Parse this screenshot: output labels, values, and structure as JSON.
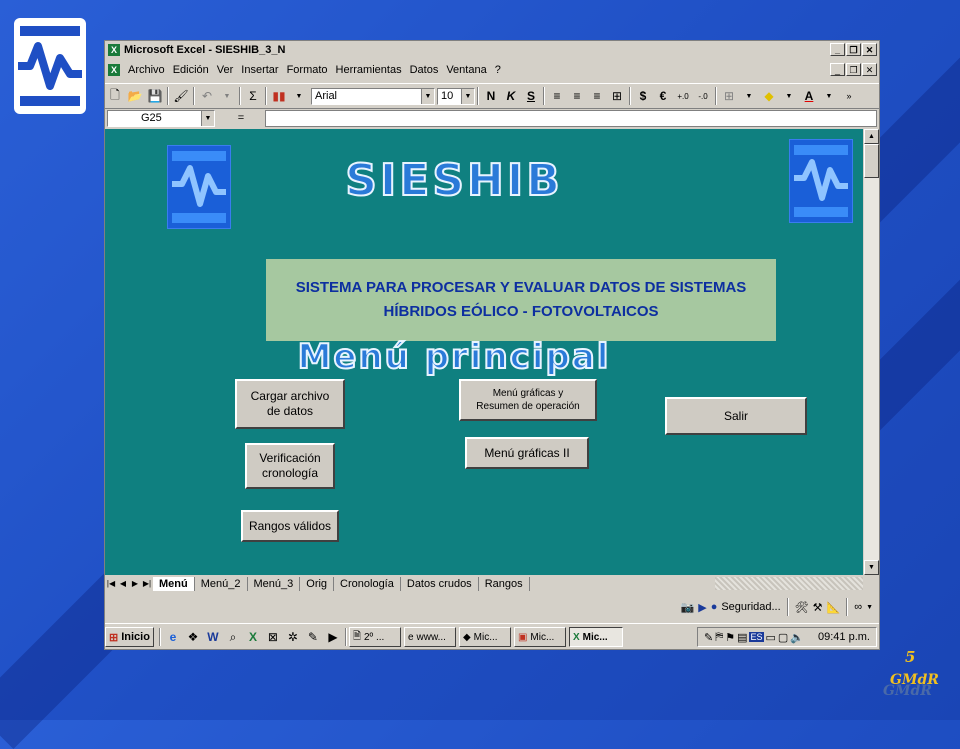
{
  "window": {
    "title": "Microsoft Excel - SIESHIB_3_N",
    "app_icon": "excel-icon"
  },
  "menu": {
    "items": [
      "Archivo",
      "Edición",
      "Ver",
      "Insertar",
      "Formato",
      "Herramientas",
      "Datos",
      "Ventana",
      "?"
    ]
  },
  "toolbar": {
    "font_name": "Arial",
    "font_size": "10",
    "bold_label": "N",
    "italic_label": "K",
    "underline_label": "S",
    "currency_label": "$",
    "euro_label": "€"
  },
  "formula_bar": {
    "name_box": "G25",
    "equals": "="
  },
  "sheet": {
    "app_name": "SIESHIB",
    "subtitle_line1": "SISTEMA PARA PROCESAR Y EVALUAR DATOS DE SISTEMAS",
    "subtitle_line2": "HÍBRIDOS EÓLICO - FOTOVOLTAICOS",
    "menu_heading": "Menú principal",
    "buttons": {
      "cargar_line1": "Cargar archivo",
      "cargar_line2": "de datos",
      "verificacion_line1": "Verificación",
      "verificacion_line2": "cronología",
      "rangos": "Rangos válidos",
      "graficas_line1": "Menú gráficas y",
      "graficas_line2": "Resumen de operación",
      "graficas2": "Menú gráficas II",
      "salir": "Salir"
    }
  },
  "tabs": [
    "Menú",
    "Menú_2",
    "Menú_3",
    "Orig",
    "Cronología",
    "Datos crudos",
    "Rangos"
  ],
  "active_tab": "Menú",
  "drawing_bar": {
    "security_label": "Seguridad..."
  },
  "taskbar": {
    "start_label": "Inicio",
    "tasks": [
      "2º ...",
      "www...",
      "Mic...",
      "Mic...",
      "Mic..."
    ],
    "language": "ES",
    "clock": "09:41 p.m."
  },
  "slide": {
    "page_number": "5",
    "author": "GMdR"
  },
  "colors": {
    "sheet_bg": "#0f8080",
    "subtitle_bg": "#a6c8a0",
    "title_text": "#2a7ad8",
    "slide_bg": "#1f4fc4"
  }
}
